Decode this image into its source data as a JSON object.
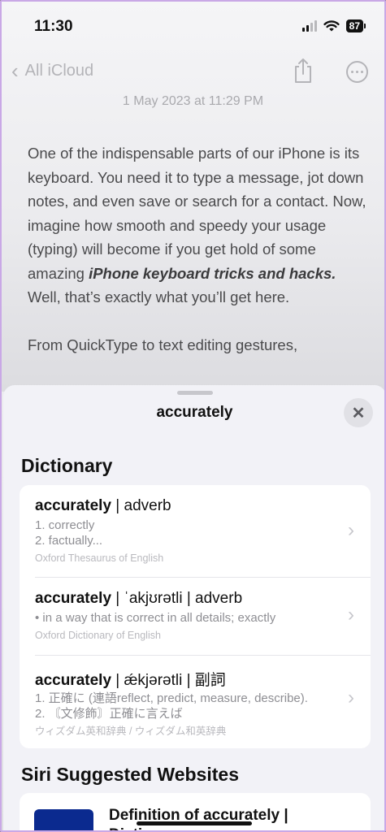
{
  "status_bar": {
    "time": "11:30",
    "battery": "87"
  },
  "nav": {
    "back_label": "All iCloud",
    "share_icon": "share-icon",
    "more_icon": "ellipsis-circle-icon"
  },
  "note": {
    "date": "1 May 2023 at 11:29 PM",
    "paragraph1_start": "One of the indispensable parts of our iPhone is its keyboard. You need it to type a message, jot down notes, and even save or search for a contact. Now, imagine how smooth and speedy your usage (typing) will become if you get hold of some amazing ",
    "paragraph1_bold": "iPhone keyboard tricks and hacks.",
    "paragraph1_end": " Well, that’s exactly what you’ll get here.",
    "paragraph2": "From QuickType to text editing gestures,"
  },
  "sheet": {
    "title": "accurately",
    "close_icon": "close-icon",
    "dictionary_heading": "Dictionary",
    "entries": [
      {
        "word": "accurately",
        "separator": " | ",
        "info": "adverb",
        "lines": [
          "1. correctly",
          "2. factually..."
        ],
        "source": "Oxford Thesaurus of English"
      },
      {
        "word": "accurately",
        "separator": " | ",
        "info": "ˈakjʊrətli  |  adverb",
        "lines": [
          "• in a way that is correct in all details; exactly"
        ],
        "source": "Oxford Dictionary of English"
      },
      {
        "word": "accurately",
        "separator": " | ",
        "info": "ǽkjərətli  |  副詞",
        "lines": [
          "1. 正確に (連語reflect, predict, measure, describe).",
          "2. 〘文修飾〙正確に言えば"
        ],
        "source": "ウィズダム英和辞典 / ウィズダム和英辞典"
      }
    ],
    "websites_heading": "Siri Suggested Websites",
    "website": {
      "title": "Definition of accurately | Dictionary.com"
    }
  },
  "colors": {
    "accent_purple_border": "#c9a8e6",
    "thumb_blue": "#0b2a8f"
  }
}
